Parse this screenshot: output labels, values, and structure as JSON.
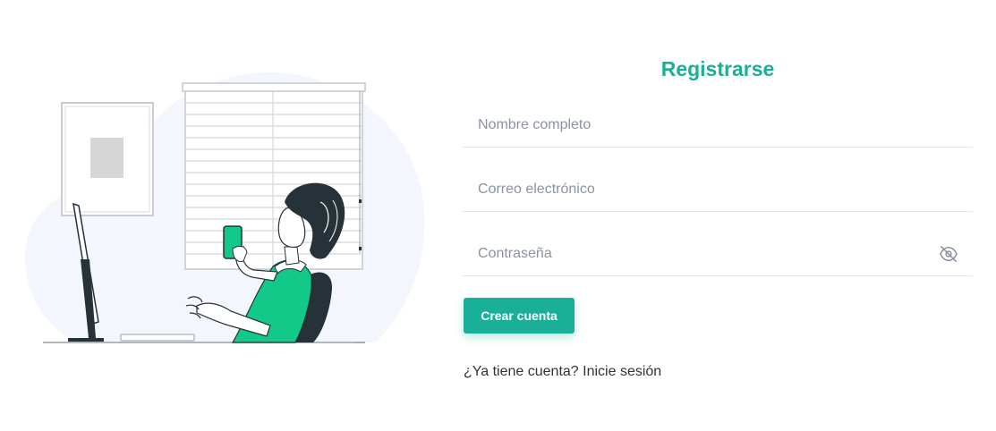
{
  "form": {
    "title": "Registrarse",
    "fields": [
      {
        "placeholder": "Nombre completo",
        "value": "",
        "type": "text"
      },
      {
        "placeholder": "Correo electrónico",
        "value": "",
        "type": "email"
      },
      {
        "placeholder": "Contraseña",
        "value": "",
        "type": "password"
      }
    ],
    "password_toggle_icon": "eye-slash-icon",
    "submit_label": "Crear cuenta",
    "login_prompt": "¿Ya tiene cuenta?",
    "login_link": "Inicie sesión"
  },
  "colors": {
    "accent": "#1aaf97",
    "illustration_green": "#12c98a",
    "illustration_dark": "#263238",
    "blob": "#f3f6fd"
  }
}
